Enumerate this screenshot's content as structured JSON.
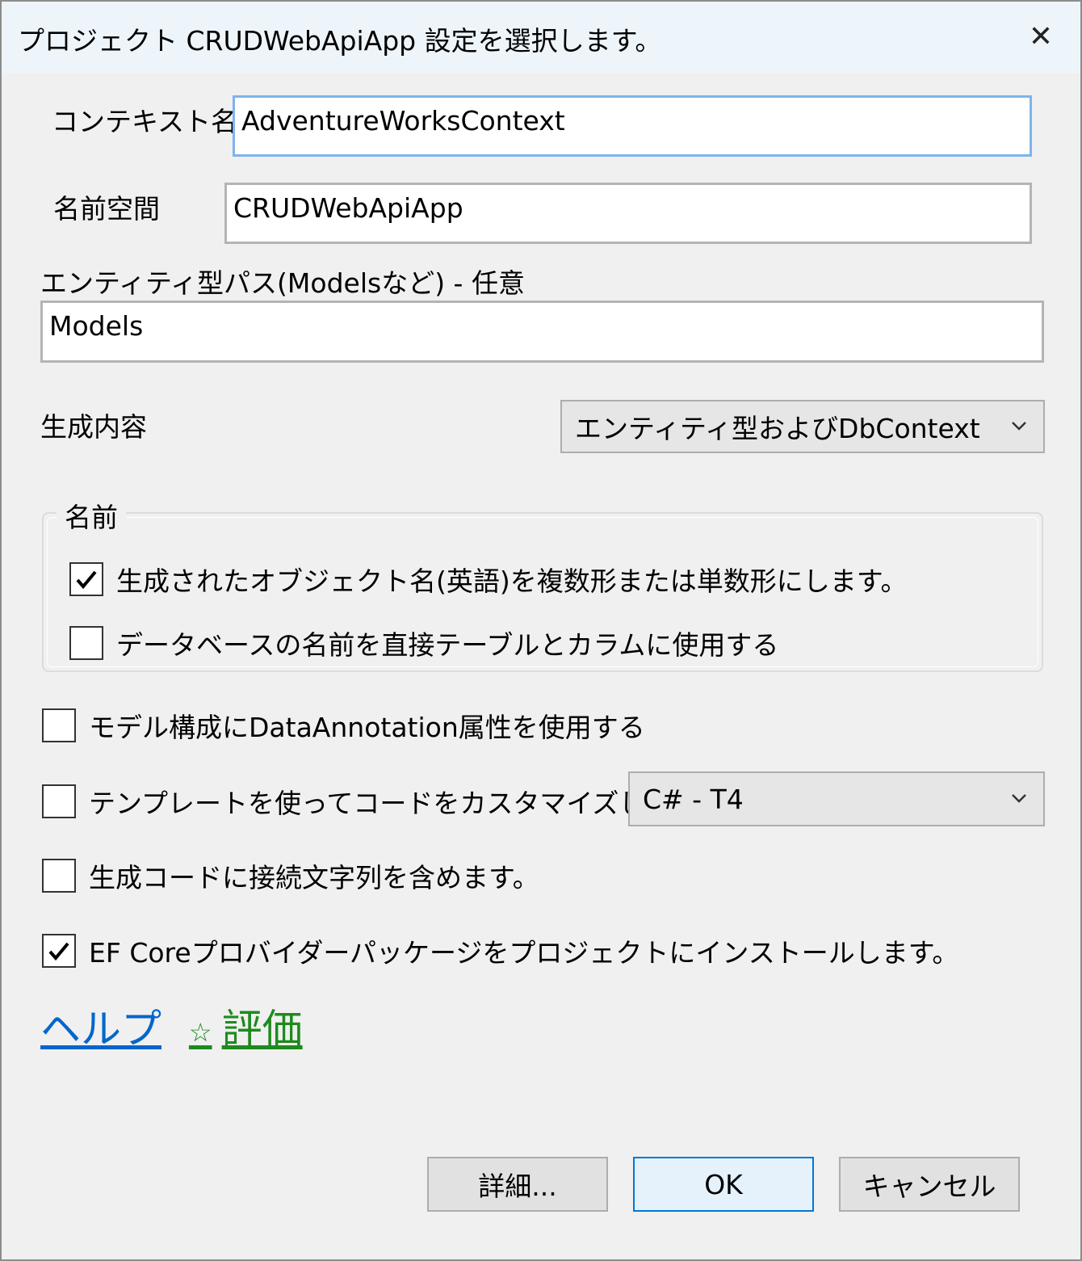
{
  "window": {
    "title": "プロジェクト CRUDWebApiApp 設定を選択します。",
    "close_glyph": "✕"
  },
  "context": {
    "label": "コンテキスト名",
    "value": "AdventureWorksContext"
  },
  "namespace": {
    "label": "名前空間",
    "value": "CRUDWebApiApp"
  },
  "entity_path": {
    "label": "エンティティ型パス(Modelsなど) - 任意",
    "value": "Models"
  },
  "generate": {
    "label": "生成内容",
    "selected": "エンティティ型およびDbContext"
  },
  "naming_group": {
    "title": "名前",
    "pluralize": {
      "label": "生成されたオブジェクト名(英語)を複数形または単数形にします。",
      "checked": true
    },
    "use_db_names": {
      "label": "データベースの名前を直接テーブルとカラムに使用する",
      "checked": false
    }
  },
  "data_annotations": {
    "label": "モデル構成にDataAnnotation属性を使用する",
    "checked": false
  },
  "templates": {
    "label": "テンプレートを使ってコードをカスタマイズします。",
    "checked": false,
    "selected": "C# - T4"
  },
  "connection_string": {
    "label": "生成コードに接続文字列を含めます。",
    "checked": false
  },
  "install_provider": {
    "label": "EF Coreプロバイダーパッケージをプロジェクトにインストールします。",
    "checked": true
  },
  "links": {
    "help": "ヘルプ",
    "rate_icon": "star-icon",
    "rate_star": "☆",
    "rate": "評価"
  },
  "buttons": {
    "advanced": "詳細...",
    "ok": "OK",
    "cancel": "キャンセル"
  },
  "colors": {
    "link_blue": "#0066cc",
    "link_green": "#1e8a1e",
    "focus_border": "#7eb4ea",
    "default_button_border": "#0078d7"
  }
}
